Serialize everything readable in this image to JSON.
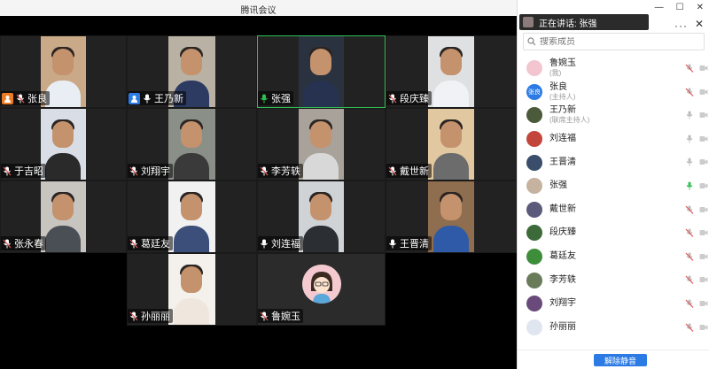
{
  "window": {
    "title": "腾讯会议"
  },
  "colors": {
    "active_speaker": "#2fbf52",
    "host_badge": "#ee7a21",
    "cohost_badge": "#2c7be5",
    "muted": "#e05555",
    "primary": "#2c7be5"
  },
  "tiles": [
    {
      "name": "张良",
      "mic": "muted",
      "badge": "host",
      "active": false
    },
    {
      "name": "王乃新",
      "mic": "on",
      "badge": "cohost",
      "active": false
    },
    {
      "name": "张强",
      "mic": "speaking",
      "badge": "",
      "active": true
    },
    {
      "name": "段庆臻",
      "mic": "muted",
      "badge": "",
      "active": false
    },
    {
      "name": "于吉昭",
      "mic": "muted",
      "badge": "",
      "active": false
    },
    {
      "name": "刘翔宇",
      "mic": "muted",
      "badge": "",
      "active": false
    },
    {
      "name": "李芳轶",
      "mic": "muted",
      "badge": "",
      "active": false
    },
    {
      "name": "戴世新",
      "mic": "muted",
      "badge": "",
      "active": false
    },
    {
      "name": "张永春",
      "mic": "muted",
      "badge": "",
      "active": false
    },
    {
      "name": "葛廷友",
      "mic": "muted",
      "badge": "",
      "active": false
    },
    {
      "name": "刘连福",
      "mic": "on",
      "badge": "",
      "active": false
    },
    {
      "name": "王晋清",
      "mic": "on",
      "badge": "",
      "active": false
    },
    {
      "name": "孙丽丽",
      "mic": "muted",
      "badge": "",
      "active": false
    },
    {
      "name": "鲁婉玉",
      "mic": "muted",
      "badge": "",
      "active": false,
      "avatar_only": true
    }
  ],
  "panel": {
    "speaking_label": "正在讲话: 张强",
    "more_icon": "more-icon",
    "search": {
      "placeholder": "搜索成员"
    },
    "members": [
      {
        "name": "鲁婉玉",
        "sub": "(我)",
        "avatar_color": "#f3c6cf",
        "mic": "muted"
      },
      {
        "name": "张良",
        "sub": "(主持人)",
        "avatar_color": "#2c7be5",
        "avatar_text": "张良",
        "mic": "muted"
      },
      {
        "name": "王乃新",
        "sub": "(联席主持人)",
        "avatar_color": "#4b5a3a",
        "mic": "on"
      },
      {
        "name": "刘连福",
        "sub": "",
        "avatar_color": "#c2463b",
        "mic": "on"
      },
      {
        "name": "王晋清",
        "sub": "",
        "avatar_color": "#3a4d6b",
        "mic": "on"
      },
      {
        "name": "张强",
        "sub": "",
        "avatar_color": "#c5b3a0",
        "mic": "speaking"
      },
      {
        "name": "戴世新",
        "sub": "",
        "avatar_color": "#5b5a7a",
        "mic": "muted"
      },
      {
        "name": "段庆臻",
        "sub": "",
        "avatar_color": "#3c6a39",
        "mic": "muted"
      },
      {
        "name": "葛廷友",
        "sub": "",
        "avatar_color": "#3d8d3a",
        "mic": "muted"
      },
      {
        "name": "李芳轶",
        "sub": "",
        "avatar_color": "#6a7b5a",
        "mic": "muted"
      },
      {
        "name": "刘翔宇",
        "sub": "",
        "avatar_color": "#6a4a7a",
        "mic": "muted"
      },
      {
        "name": "孙丽丽",
        "sub": "",
        "avatar_color": "#dfe6ef",
        "mic": "muted"
      }
    ],
    "unmute_all_label": "解除静音"
  }
}
